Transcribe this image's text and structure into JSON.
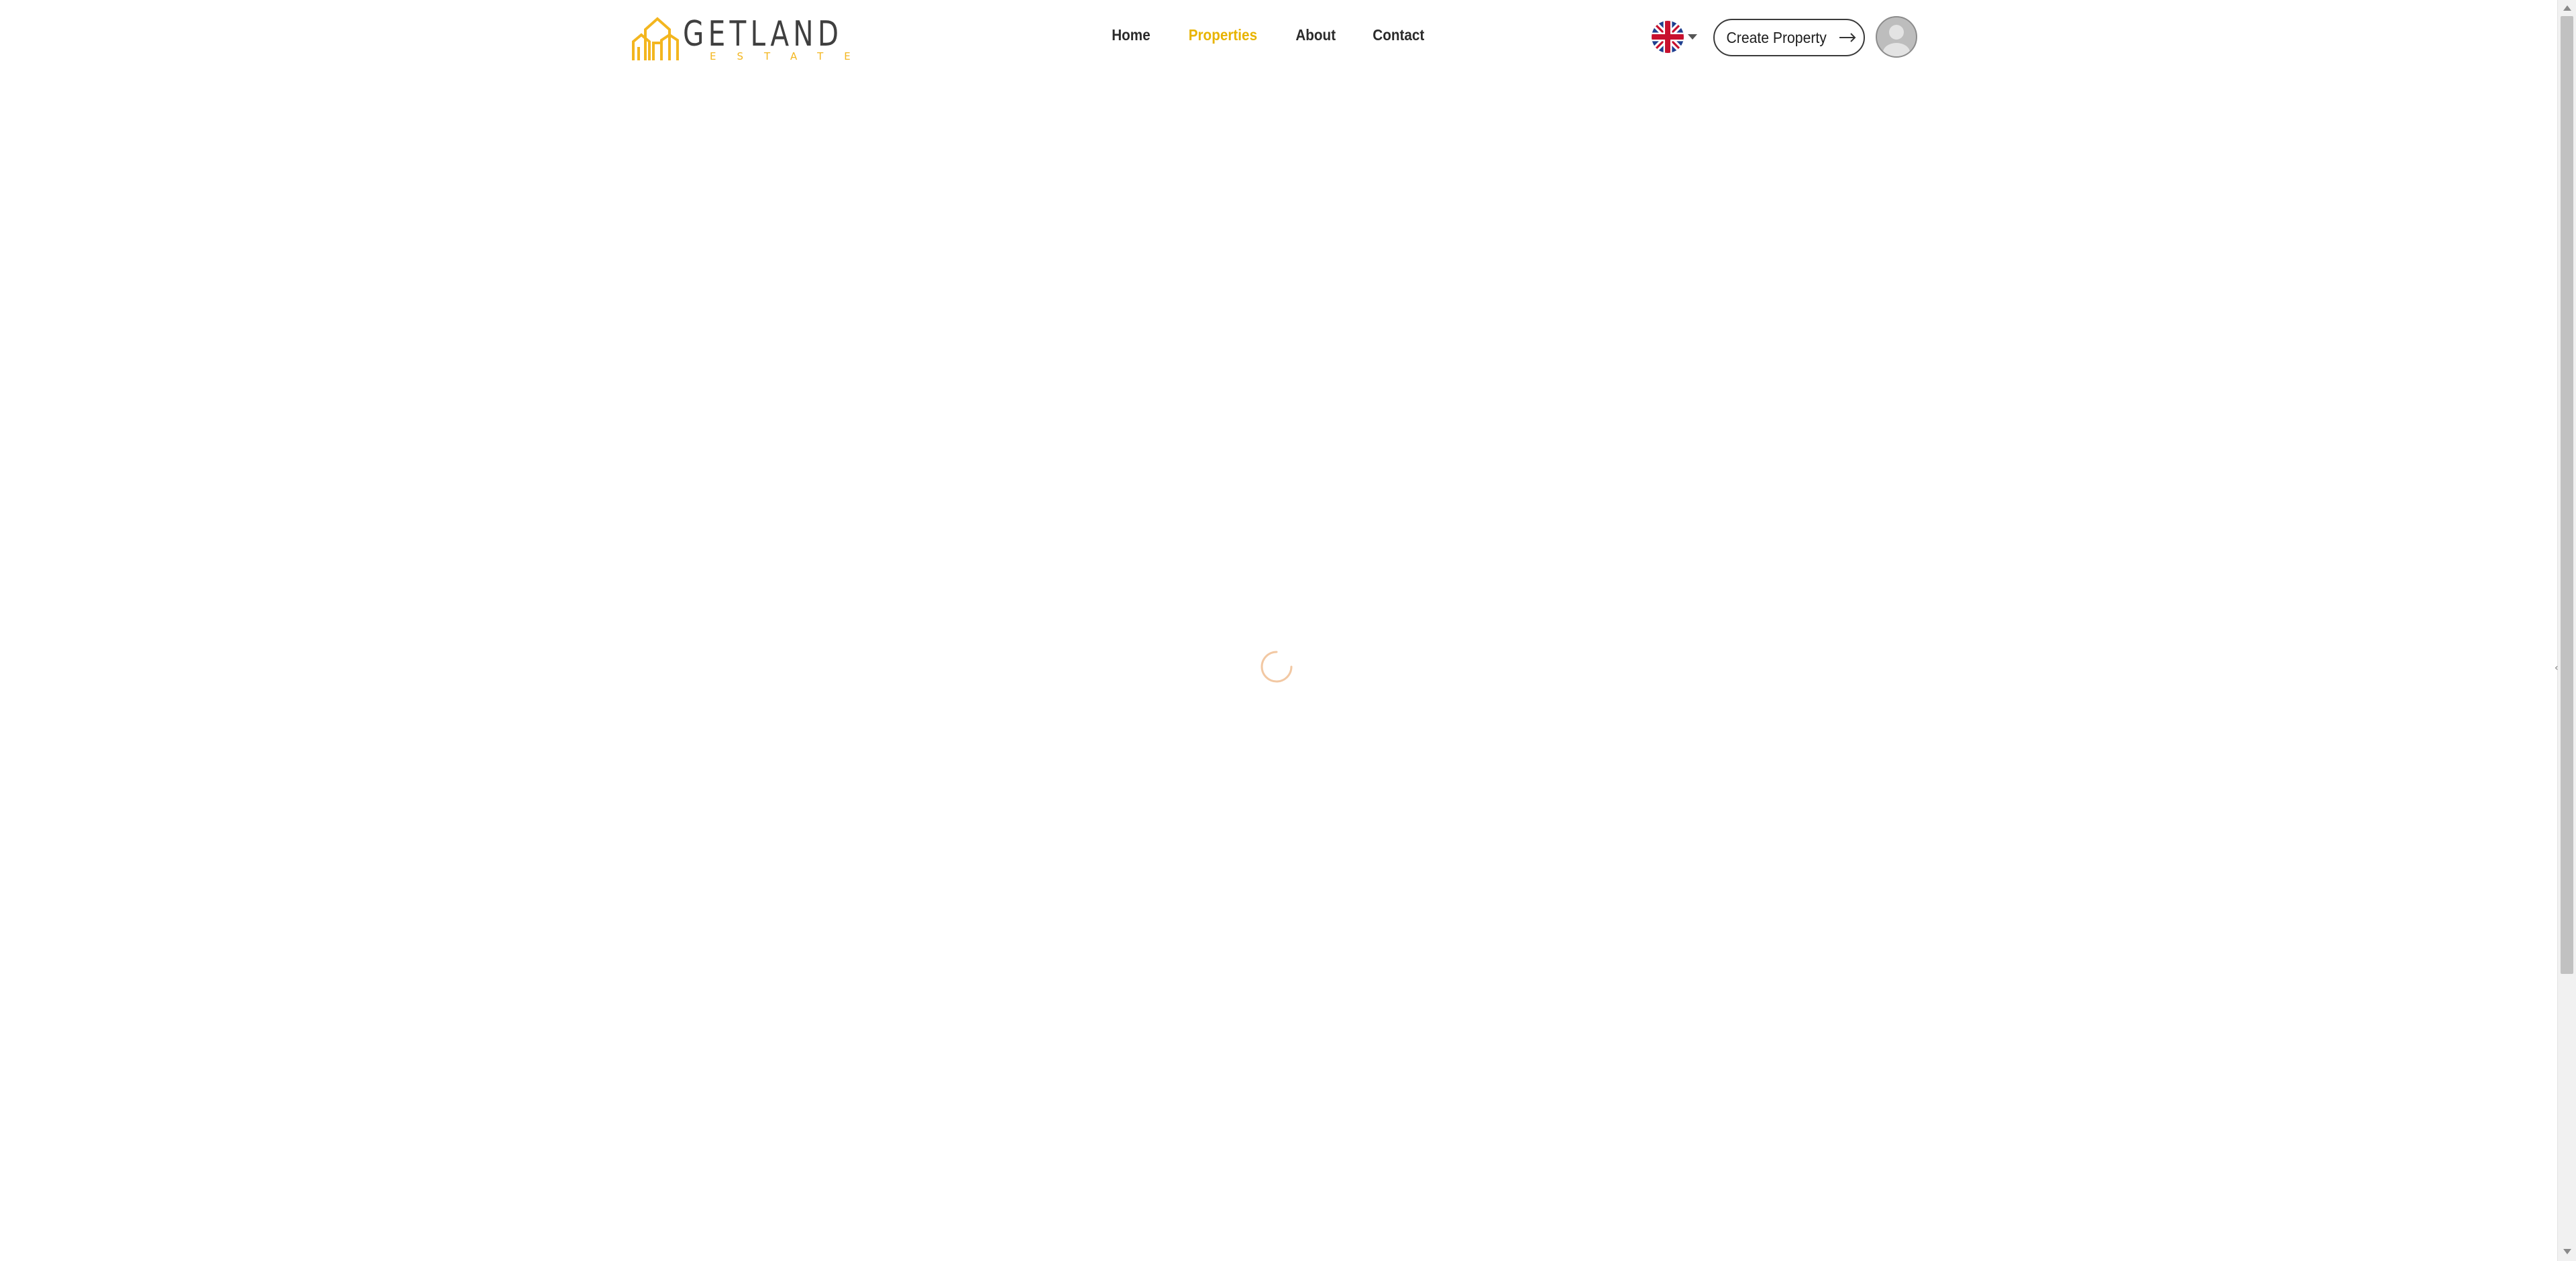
{
  "brand": {
    "name": "GETLAND",
    "tagline": "ESTATE",
    "accent_color": "#f3b61f",
    "text_color": "#3f3f3f"
  },
  "nav": {
    "items": [
      {
        "label": "Home",
        "active": false
      },
      {
        "label": "Properties",
        "active": true
      },
      {
        "label": "About",
        "active": false
      },
      {
        "label": "Contact",
        "active": false
      }
    ],
    "active_color": "#e8b400"
  },
  "language_selector": {
    "flag_icon": "uk-flag-icon",
    "dropdown_icon": "caret-down-icon"
  },
  "create_property": {
    "label": "Create Property",
    "icon": "arrow-right-icon"
  },
  "user": {
    "avatar_icon": "user-avatar-icon"
  },
  "main": {
    "state": "loading",
    "spinner_color": "#f2c8a3"
  }
}
